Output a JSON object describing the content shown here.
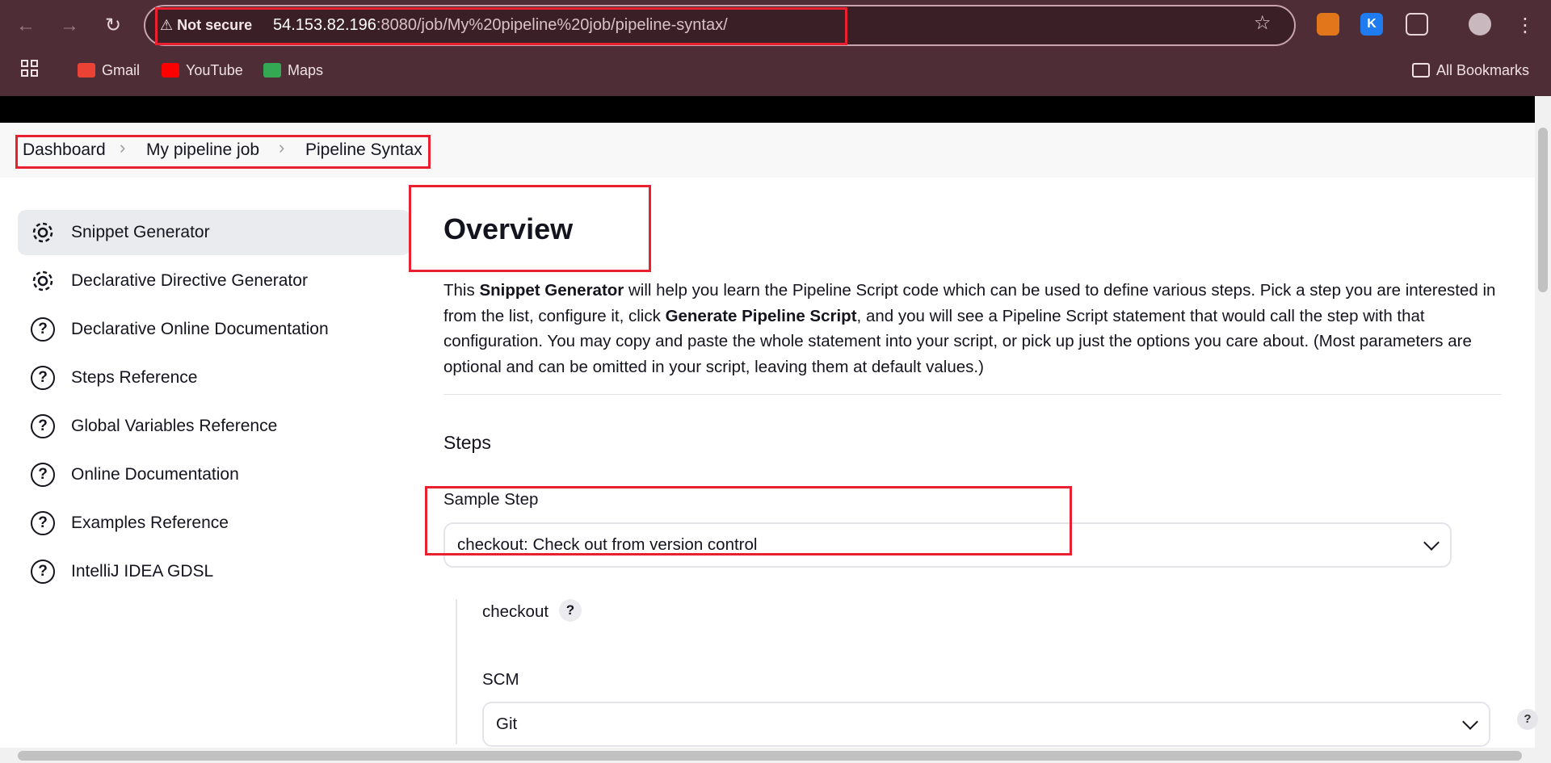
{
  "browser": {
    "security_label": "Not secure",
    "url_host": "54.153.82.196",
    "url_rest": ":8080/job/My%20pipeline%20job/pipeline-syntax/",
    "bookmarks": [
      {
        "label": "Gmail",
        "color": "#ea4335"
      },
      {
        "label": "YouTube",
        "color": "#ff0000"
      },
      {
        "label": "Maps",
        "color": "#34a853"
      }
    ],
    "all_bookmarks": "All Bookmarks"
  },
  "breadcrumb": {
    "items": [
      "Dashboard",
      "My pipeline job",
      "Pipeline Syntax"
    ]
  },
  "sidebar": {
    "items": [
      {
        "label": "Snippet Generator",
        "icon": "gear-icon",
        "active": true
      },
      {
        "label": "Declarative Directive Generator",
        "icon": "gear-icon"
      },
      {
        "label": "Declarative Online Documentation",
        "icon": "help-circle-icon"
      },
      {
        "label": "Steps Reference",
        "icon": "help-circle-icon"
      },
      {
        "label": "Global Variables Reference",
        "icon": "help-circle-icon"
      },
      {
        "label": "Online Documentation",
        "icon": "help-circle-icon"
      },
      {
        "label": "Examples Reference",
        "icon": "help-circle-icon"
      },
      {
        "label": "IntelliJ IDEA GDSL",
        "icon": "help-circle-icon"
      }
    ]
  },
  "main": {
    "title": "Overview",
    "desc_1": "This ",
    "desc_b1": "Snippet Generator",
    "desc_2": " will help you learn the Pipeline Script code which can be used to define various steps. Pick a step you are interested in from the list, configure it, click ",
    "desc_b2": "Generate Pipeline Script",
    "desc_3": ", and you will see a Pipeline Script statement that would call the step with that configuration. You may copy and paste the whole statement into your script, or pick up just the options you care about. (Most parameters are optional and can be omitted in your script, leaving them at default values.)",
    "steps_heading": "Steps",
    "sample_step_label": "Sample Step",
    "sample_step_value": "checkout: Check out from version control",
    "checkout_label": "checkout",
    "help_symbol": "?",
    "scm_label": "SCM",
    "scm_value": "Git"
  },
  "colors": {
    "highlight": "#e8202f",
    "chrome": "#4f2d36"
  }
}
